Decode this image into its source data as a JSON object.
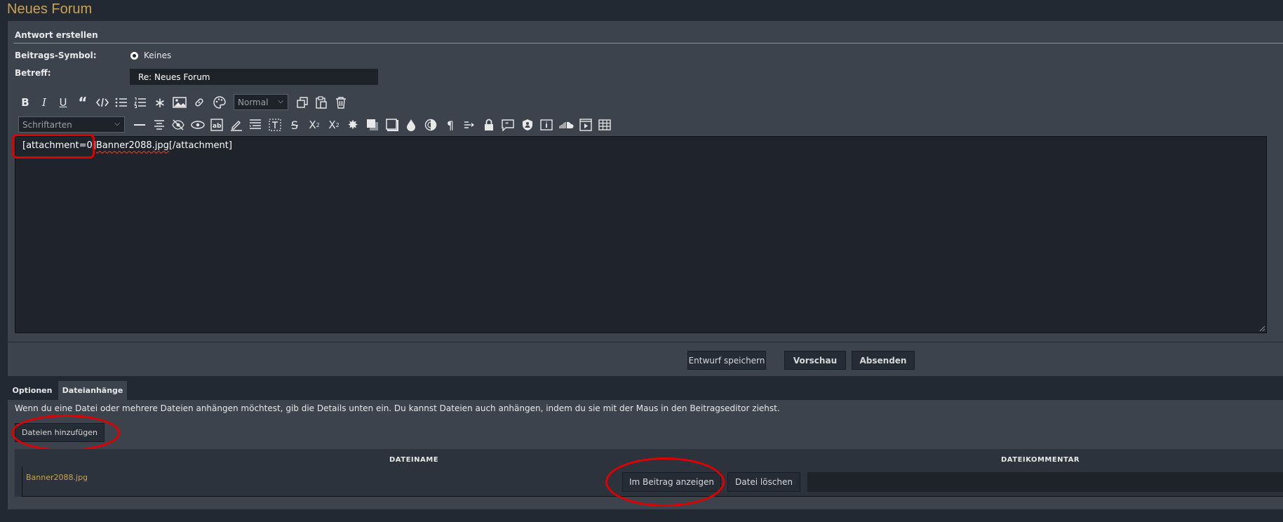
{
  "page": {
    "title": "Neues Forum"
  },
  "reply": {
    "heading": "Antwort erstellen",
    "icon_label": "Beitrags-Symbol:",
    "icon_option": "Keines",
    "subject_label": "Betreff:",
    "subject_value": "Re: Neues Forum"
  },
  "toolbar": {
    "size_select": "Normal",
    "font_select": "Schriftarten"
  },
  "editor": {
    "content_prefix": "[attachment=0]",
    "content_word": "Banner2088.jpg",
    "content_suffix": "[/attachment]"
  },
  "actions": {
    "save_draft": "Entwurf speichern",
    "preview": "Vorschau",
    "submit": "Absenden"
  },
  "tabs": [
    {
      "label": "Optionen",
      "active": false
    },
    {
      "label": "Dateianhänge",
      "active": true
    }
  ],
  "attachments": {
    "info": "Wenn du eine Datei oder mehrere Dateien anhängen möchtest, gib die Details unten ein. Du kannst Dateien auch anhängen, indem du sie mit der Maus in den Beitragseditor ziehst.",
    "add_button": "Dateien hinzufügen",
    "col_filename": "DATEINAME",
    "col_comment": "DATEIKOMMENTAR",
    "file_name": "Banner2088.jpg",
    "show_in_post": "Im Beitrag anzeigen",
    "delete_file": "Datei löschen"
  },
  "colors": {
    "accent_gold": "#c9a350",
    "panel": "#3d434c",
    "background": "#222933",
    "highlight_red": "#e00000"
  },
  "icons": [
    "bold-icon",
    "italic-icon",
    "underline-icon",
    "quote-icon",
    "code-icon",
    "bullet-list-icon",
    "numbered-list-icon",
    "asterisk-icon",
    "image-icon",
    "link-icon",
    "palette-icon",
    "copy-icon",
    "paste-icon",
    "trash-icon",
    "horizontal-rule-icon",
    "align-center-icon",
    "hide-icon",
    "spoiler-icon",
    "abbr-icon",
    "highlight-icon",
    "align-justify-icon",
    "text-box-icon",
    "strikethrough-icon",
    "superscript-icon",
    "subscript-icon",
    "glow-icon",
    "shadow-icon",
    "box-icon",
    "droplet-icon",
    "blur-icon",
    "paragraph-icon",
    "indent-icon",
    "lock-icon",
    "comment-icon",
    "shield-icon",
    "info-icon",
    "soundcloud-icon",
    "video-icon",
    "table-icon"
  ]
}
